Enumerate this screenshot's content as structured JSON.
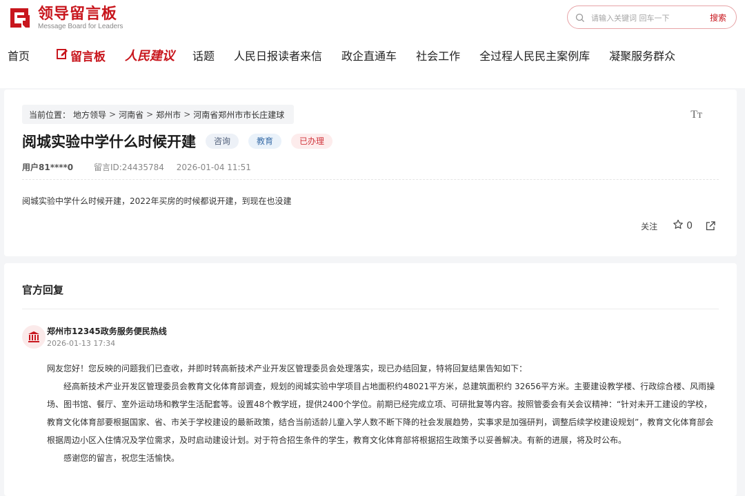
{
  "brand": {
    "name_cn": "领导留言板",
    "name_en": "Message Board for Leaders",
    "color": "#c8161d"
  },
  "search": {
    "placeholder": "请输入关键词 回车一下",
    "button": "搜索",
    "icon": "search-icon"
  },
  "nav": {
    "items": [
      {
        "label": "首页"
      },
      {
        "label": "留言板",
        "icon": "edit-icon"
      },
      {
        "label": "人民建议"
      },
      {
        "label": "话题"
      },
      {
        "label": "人民日报读者来信"
      },
      {
        "label": "政企直通车"
      },
      {
        "label": "社会工作"
      },
      {
        "label": "全过程人民民主案例库"
      },
      {
        "label": "凝聚服务群众"
      }
    ]
  },
  "breadcrumb": {
    "prefix": "当前位置：",
    "items": [
      "地方领导",
      "河南省",
      "郑州市",
      "河南省郑州市市长庄建球"
    ],
    "separator": ">"
  },
  "font_toggle": "Tт",
  "message": {
    "title": "阅城实验中学什么时候开建",
    "tags": [
      "咨询",
      "教育",
      "已办理"
    ],
    "user": "用户81****0",
    "id_label": "留言ID:24435784",
    "time": "2026-01-04 11:51",
    "content": "阅城实验中学什么时候开建，2022年买房的时候都说开建，到现在也没建",
    "follow": "关注",
    "stars": "0"
  },
  "reply": {
    "section_title": "官方回复",
    "org": "郑州市12345政务服务便民热线",
    "time": "2026-01-13 17:34",
    "avatar_icon": "government-building-icon",
    "paragraphs": [
      "网友您好！您反映的问题我们已查收，并即时转高新技术产业开发区管理委员会处理落实，现已办结回复，特将回复结果告知如下：",
      "经高新技术产业开发区管理委员会教育文化体育部调查，规划的阅城实验中学项目占地面积约48021平方米，总建筑面积约 32656平方米。主要建设教学楼、行政综合楼、风雨操场、图书馆、餐厅、室外运动场和教学生活配套等。设置48个教学班，提供2400个学位。前期已经完成立项、可研批复等内容。按照管委会有关会议精神：“针对未开工建设的学校，教育文化体育部要根据国家、省、市关于学校建设的最新政策，结合当前适龄儿童入学人数不断下降的社会发展趋势，实事求是加强研判，调整后续学校建设规划”，教育文化体育部会根据周边小区入住情况及学位需求，及时启动建设计划。对于符合招生条件的学生，教育文化体育部将根据招生政策予以妥善解决。有新的进展，将及时公布。",
      "感谢您的留言，祝您生活愉快。"
    ]
  }
}
